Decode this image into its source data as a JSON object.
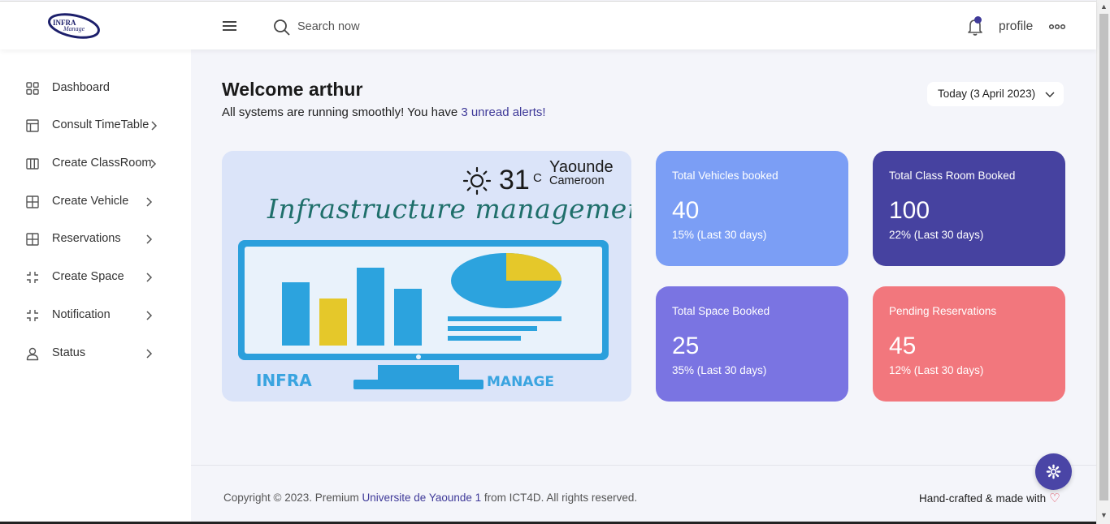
{
  "brand": {
    "logo_text_top": "INFRA",
    "logo_text_bottom": "Manage"
  },
  "header": {
    "search_placeholder": "Search now",
    "profile_label": "profile"
  },
  "sidebar": {
    "items": [
      {
        "label": "Dashboard",
        "icon": "dashboard-grid-icon",
        "has_chevron": false
      },
      {
        "label": "Consult TimeTable",
        "icon": "timetable-icon",
        "has_chevron": true
      },
      {
        "label": "Create ClassRoom",
        "icon": "classroom-columns-icon",
        "has_chevron": true
      },
      {
        "label": "Create Vehicle",
        "icon": "vehicle-grid-icon",
        "has_chevron": true
      },
      {
        "label": "Reservations",
        "icon": "reservations-grid-icon",
        "has_chevron": true
      },
      {
        "label": "Create Space",
        "icon": "space-corners-icon",
        "has_chevron": true
      },
      {
        "label": "Notification",
        "icon": "notification-corners-icon",
        "has_chevron": true
      },
      {
        "label": "Status",
        "icon": "user-icon",
        "has_chevron": true
      }
    ]
  },
  "main": {
    "welcome": "Welcome arthur",
    "status_prefix": "All systems are running smoothly! You have ",
    "alerts_link": "3 unread alerts!",
    "date_button": "Today (3 April 2023)"
  },
  "banner": {
    "temperature": "31",
    "temperature_unit": "C",
    "city": "Yaounde",
    "country": "Cameroon",
    "title": "Infrastructure management",
    "art_left_text": "INFRA",
    "art_right_text": "MANAGE"
  },
  "cards": [
    {
      "title": "Total Vehicles booked",
      "value": "40",
      "sub": "15% (Last 30 days)",
      "color": "#7b9ef5"
    },
    {
      "title": "Total Class Room Booked",
      "value": "100",
      "sub": "22% (Last 30 days)",
      "color": "#4642a0"
    },
    {
      "title": "Total Space Booked",
      "value": "25",
      "sub": "35% (Last 30 days)",
      "color": "#7a74e2"
    },
    {
      "title": "Pending Reservations",
      "value": "45",
      "sub": "12% (Last 30 days)",
      "color": "#f2777d"
    }
  ],
  "footer": {
    "copyright_prefix": "Copyright © 2023. Premium ",
    "university_link": "Universite de Yaounde 1",
    "copyright_suffix": " from ICT4D. All rights reserved.",
    "made_with": "Hand-crafted & made with"
  },
  "colors": {
    "accent": "#3f3a99",
    "background": "#f4f5fa",
    "banner_bg": "#dbe4f9"
  }
}
